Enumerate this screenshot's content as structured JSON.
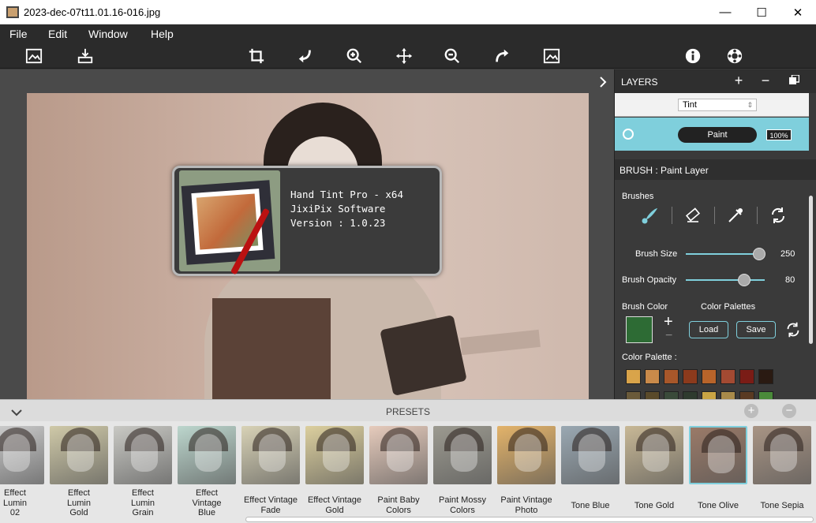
{
  "window": {
    "title": "2023-dec-07t11.01.16-016.jpg",
    "minimize": "—",
    "maximize": "☐",
    "close": "✕"
  },
  "menu": [
    "File",
    "Edit",
    "Window",
    "Help"
  ],
  "about": {
    "product": "Hand Tint Pro - x64",
    "company": "JixiPix Software",
    "version": "Version : 1.0.23"
  },
  "layers": {
    "title": "LAYERS",
    "add": "+",
    "remove": "−",
    "items": [
      {
        "mode": "Tint"
      },
      {
        "name": "Paint",
        "opacity": "100%"
      }
    ]
  },
  "brush": {
    "header": "BRUSH : Paint Layer",
    "brushes_label": "Brushes",
    "size_label": "Brush Size",
    "size_value": "250",
    "size_fraction": 0.93,
    "opacity_label": "Brush Opacity",
    "opacity_value": "80",
    "opacity_fraction": 0.74,
    "color_label": "Brush Color",
    "palettes_label": "Color Palettes",
    "add": "+",
    "remove": "−",
    "load": "Load",
    "save": "Save",
    "palette_label": "Color Palette :",
    "palette_row1": [
      "#d9a44a",
      "#c98a4a",
      "#a8572a",
      "#8c3a1c",
      "#b8642a",
      "#a34a32",
      "#7a1c16",
      "#2a1a12"
    ],
    "palette_row2": [
      "#6a5a3a",
      "#5a4a2a",
      "#3a4a3a",
      "#2e3a2e",
      "#c9a444",
      "#a88a4a",
      "#5a3a22",
      "#4a8a3a"
    ]
  },
  "presets": {
    "title": "PRESETS",
    "items": [
      {
        "label": "Effect\nLumin\n02",
        "tone": "#cfcfcf"
      },
      {
        "label": "Effect\nLumin\nGold",
        "tone": "#cfc9a8"
      },
      {
        "label": "Effect\nLumin\nGrain",
        "tone": "#c9c9c4"
      },
      {
        "label": "Effect\nVintage\nBlue",
        "tone": "#bcd6cd"
      },
      {
        "label": "Effect Vintage\nFade",
        "tone": "#d8d2b6"
      },
      {
        "label": "Effect Vintage\nGold",
        "tone": "#dccf9e"
      },
      {
        "label": "Paint Baby\nColors",
        "tone": "#e6cbbc"
      },
      {
        "label": "Paint Mossy\nColors",
        "tone": "#9c9a90"
      },
      {
        "label": "Paint Vintage\nPhoto",
        "tone": "#e3b36a"
      },
      {
        "label": "Tone Blue",
        "tone": "#9aa8b2"
      },
      {
        "label": "Tone Gold",
        "tone": "#c8b896"
      },
      {
        "label": "Tone Olive",
        "tone": "#9a7a68",
        "selected": true
      },
      {
        "label": "Tone Sepia",
        "tone": "#a89484"
      }
    ]
  },
  "colors": {
    "accent": "#7fcfdc",
    "dark": "#2b2b2b"
  }
}
